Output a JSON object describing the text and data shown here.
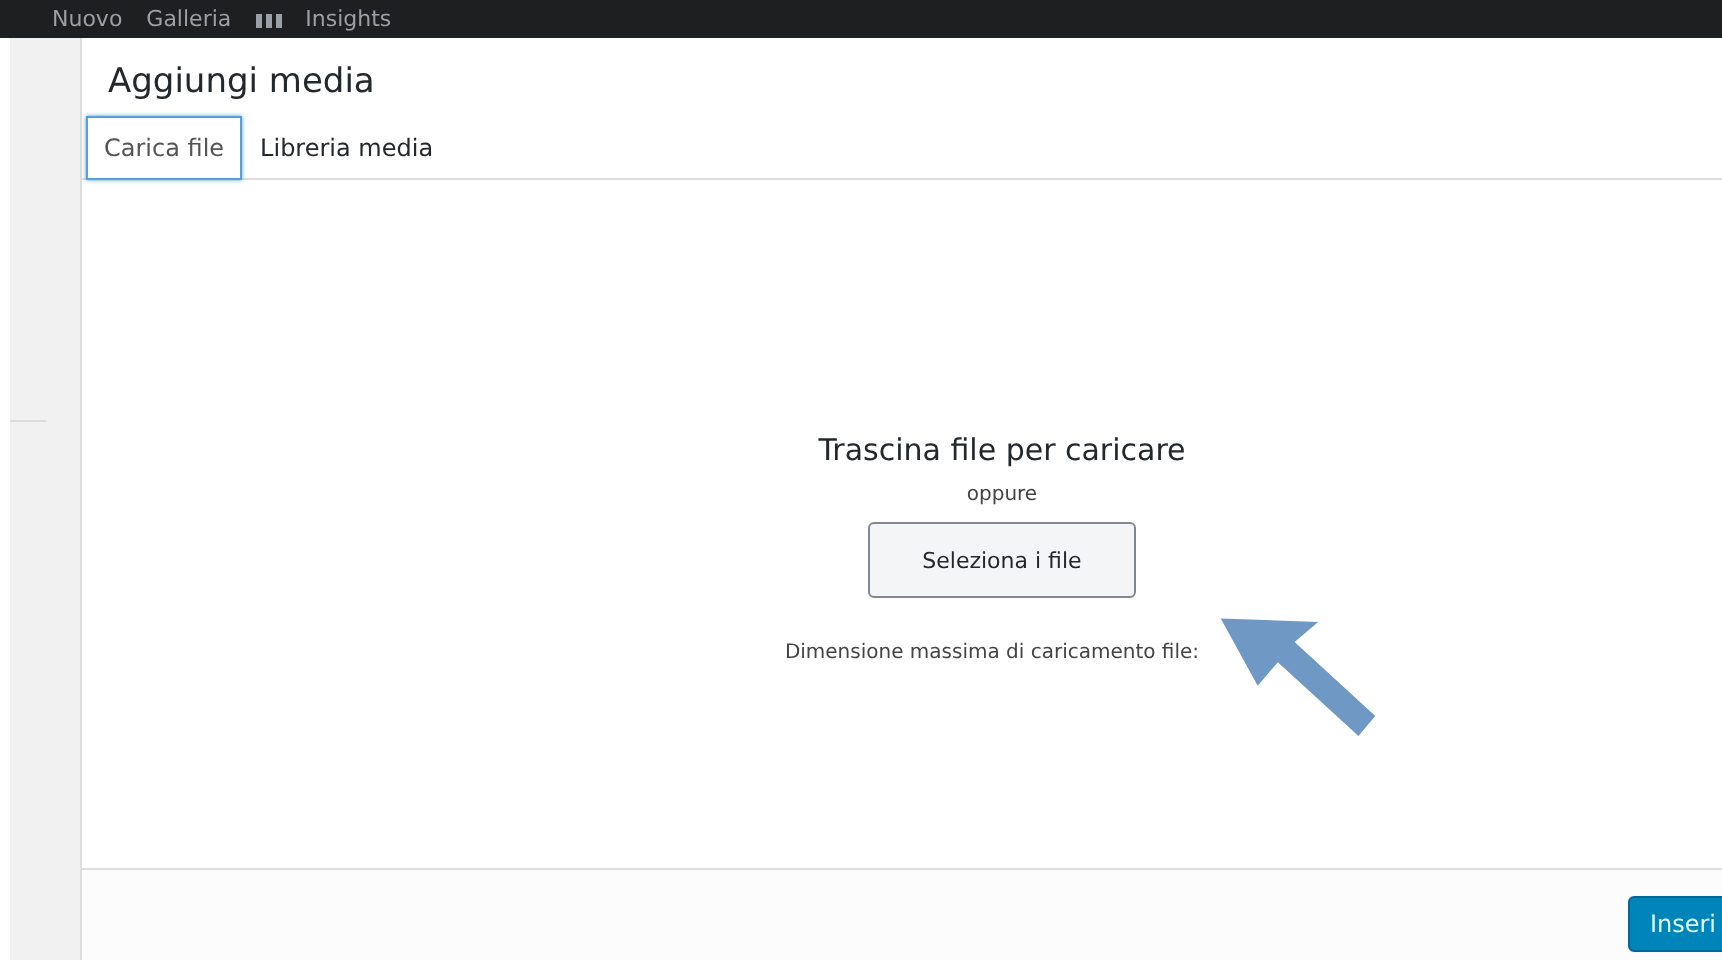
{
  "admin_bar": {
    "items": [
      {
        "label": "Nuovo"
      },
      {
        "label": "Galleria"
      },
      {
        "label": "Insights"
      }
    ]
  },
  "modal": {
    "title": "Aggiungi media",
    "tabs": [
      {
        "label": "Carica file",
        "selected": true
      },
      {
        "label": "Libreria media",
        "selected": false
      }
    ],
    "uploader": {
      "heading": "Trascina file per caricare",
      "separator": "oppure",
      "select_button": "Seleziona i file",
      "max_size_note": "Dimensione massima di caricamento file:"
    },
    "footer": {
      "insert_button": "Inseri"
    }
  }
}
